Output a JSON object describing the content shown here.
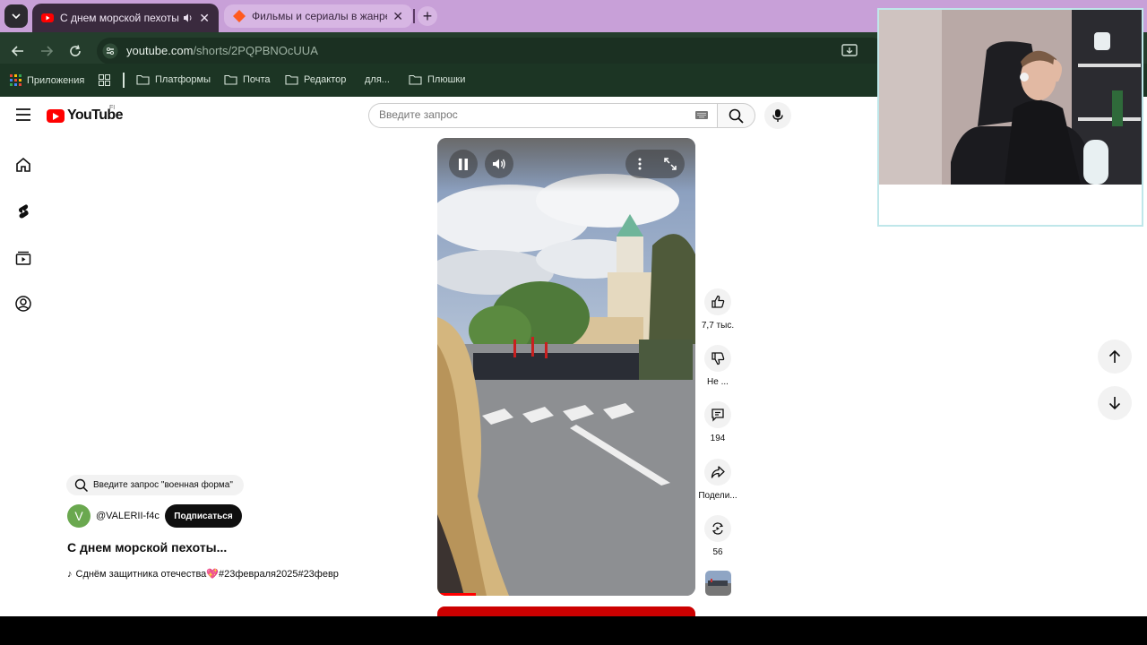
{
  "browser": {
    "tabs": [
      {
        "title": "С днем морской пехоты💖",
        "active": true
      },
      {
        "title": "Фильмы и сериалы в жанре К",
        "active": false
      }
    ],
    "url_host": "youtube.com",
    "url_path": "/shorts/2PQPBNOcUUA",
    "bookmarks": [
      {
        "label": "Приложения",
        "icon": "apps-grid-icon"
      },
      {
        "label": "Платформы",
        "icon": "folder-icon"
      },
      {
        "label": "Почта",
        "icon": "folder-icon"
      },
      {
        "label": "Редактор",
        "icon": "folder-icon"
      },
      {
        "label": "для...",
        "icon": "none"
      },
      {
        "label": "Плюшки",
        "icon": "folder-icon"
      }
    ]
  },
  "youtube": {
    "logo_text": "YouTube",
    "region": "FI",
    "search_placeholder": "Введите запрос",
    "short": {
      "search_suggestion": "Введите запрос \"военная форма\"",
      "channel_initial": "V",
      "channel_handle": "@VALERII-f4c",
      "subscribe_label": "Подписаться",
      "title": "С днем морской пехоты...",
      "music_text": "Сднём защитника отечества",
      "hashtags": "#23февраля2025#23февр",
      "progress": 0.15,
      "actions": {
        "likes": "7,7 тыс.",
        "dislike": "Не ...",
        "comments": "194",
        "share": "Подели...",
        "remix": "56"
      }
    }
  },
  "colors": {
    "tabbar": "#c8a0d8",
    "toolbar": "#243d2c",
    "bookmarks_bar": "#1c3524",
    "yt_red": "#ff0000"
  }
}
